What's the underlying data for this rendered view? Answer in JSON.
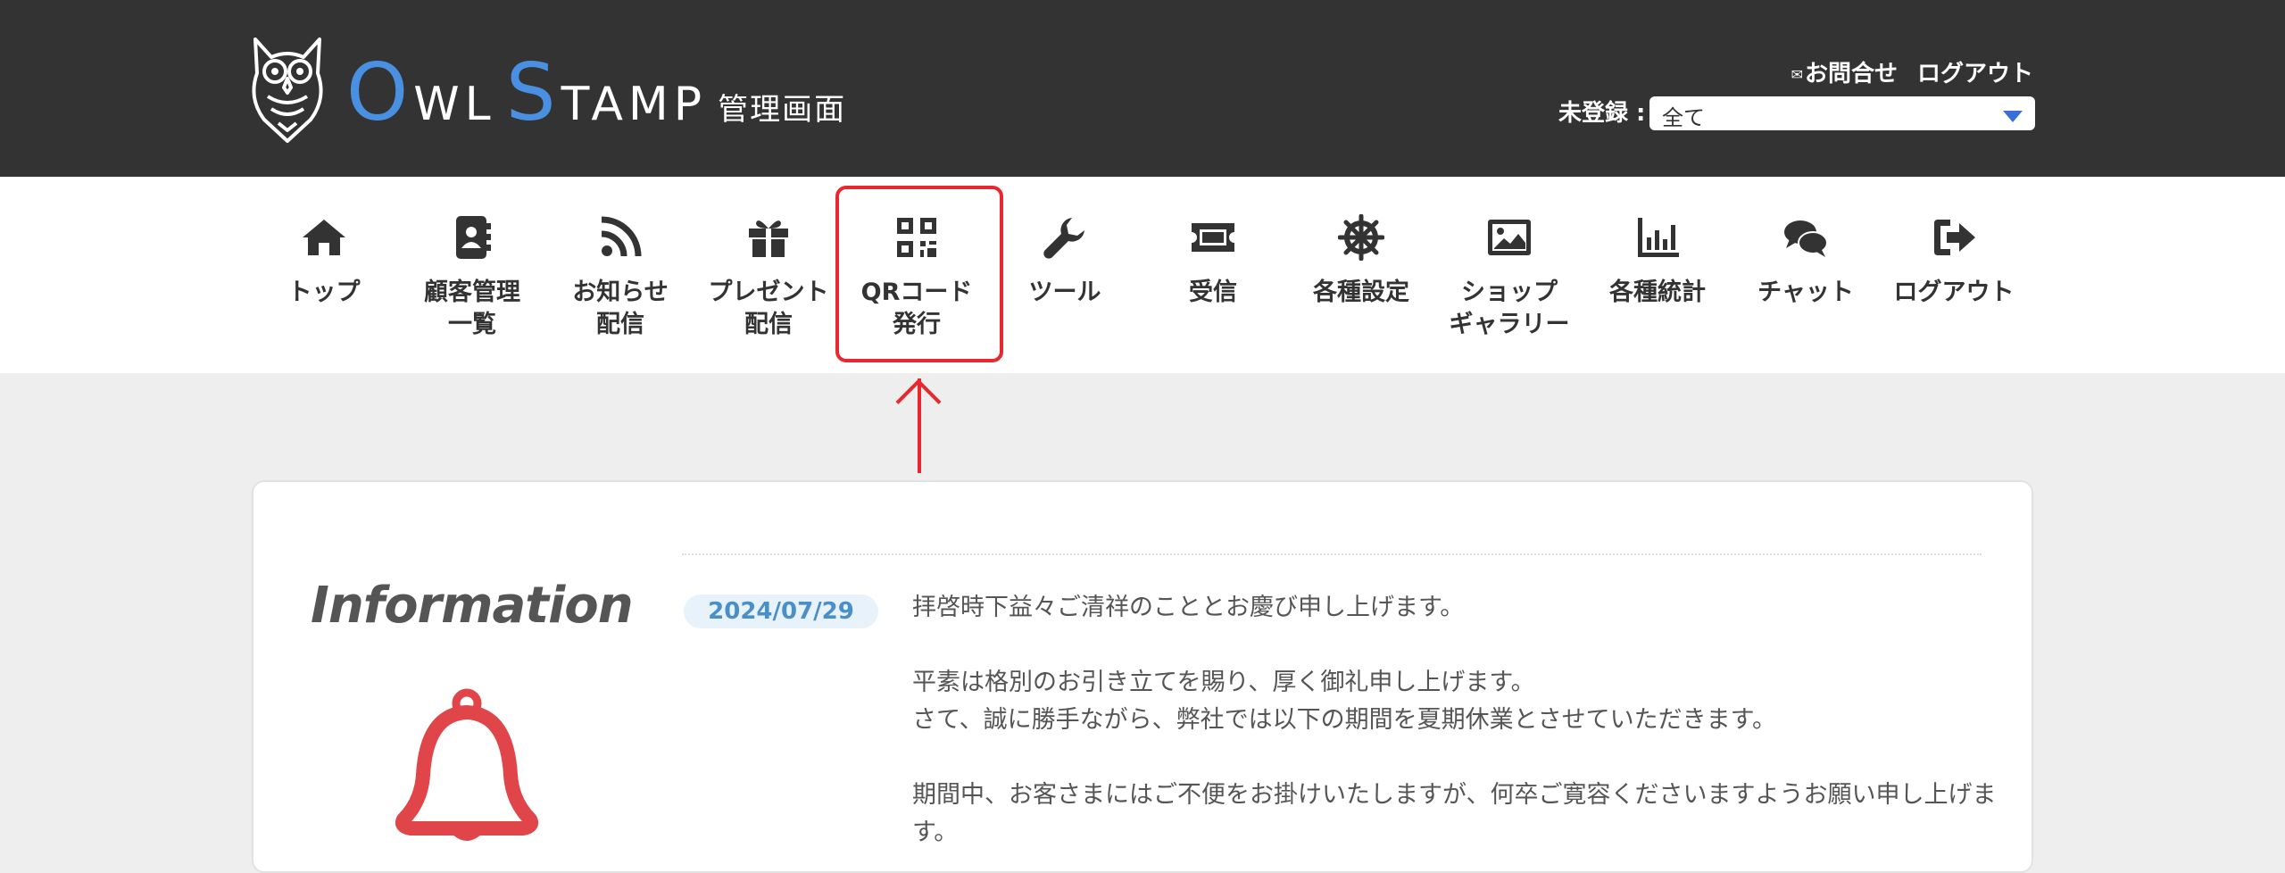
{
  "header": {
    "logo": {
      "o": "O",
      "wl": "WL",
      "s": "S",
      "tamp": "TAMP",
      "subtitle": "管理画面"
    },
    "contact_label": "お問合せ",
    "contact_icon": "mail-icon",
    "logout_label": "ログアウト",
    "filter_label": "未登録 :",
    "filter_value": "全て"
  },
  "nav": {
    "items": [
      {
        "label": "トップ",
        "icon": "home-icon"
      },
      {
        "label": "顧客管理\n一覧",
        "icon": "address-book-icon"
      },
      {
        "label": "お知らせ\n配信",
        "icon": "rss-icon"
      },
      {
        "label": "プレゼント\n配信",
        "icon": "gift-icon"
      },
      {
        "label": "QRコード\n発行",
        "icon": "qrcode-icon"
      },
      {
        "label": "ツール",
        "icon": "wrench-icon"
      },
      {
        "label": "受信",
        "icon": "ticket-icon"
      },
      {
        "label": "各種設定",
        "icon": "helm-icon"
      },
      {
        "label": "ショップ\nギャラリー",
        "icon": "image-icon"
      },
      {
        "label": "各種統計",
        "icon": "chart-icon"
      },
      {
        "label": "チャット",
        "icon": "chat-icon"
      },
      {
        "label": "ログアウト",
        "icon": "sign-out-icon"
      }
    ]
  },
  "info": {
    "title": "Information",
    "date": "2024/07/29",
    "lines": [
      "拝啓時下益々ご清祥のこととお慶び申し上げます。",
      "平素は格別のお引き立てを賜り、厚く御礼申し上げます。",
      "さて、誠に勝手ながら、弊社では以下の期間を夏期休業とさせていただきます。",
      "期間中、お客さまにはご不便をお掛けいたしますが、何卒ご寛容くださいますようお願い申し上げます。"
    ]
  },
  "colors": {
    "header_bg": "#333333",
    "logo_accent": "#4a90e2",
    "highlight": "#e8282e",
    "bell": "#e0454a",
    "date_badge_text": "#4a8fc8"
  }
}
